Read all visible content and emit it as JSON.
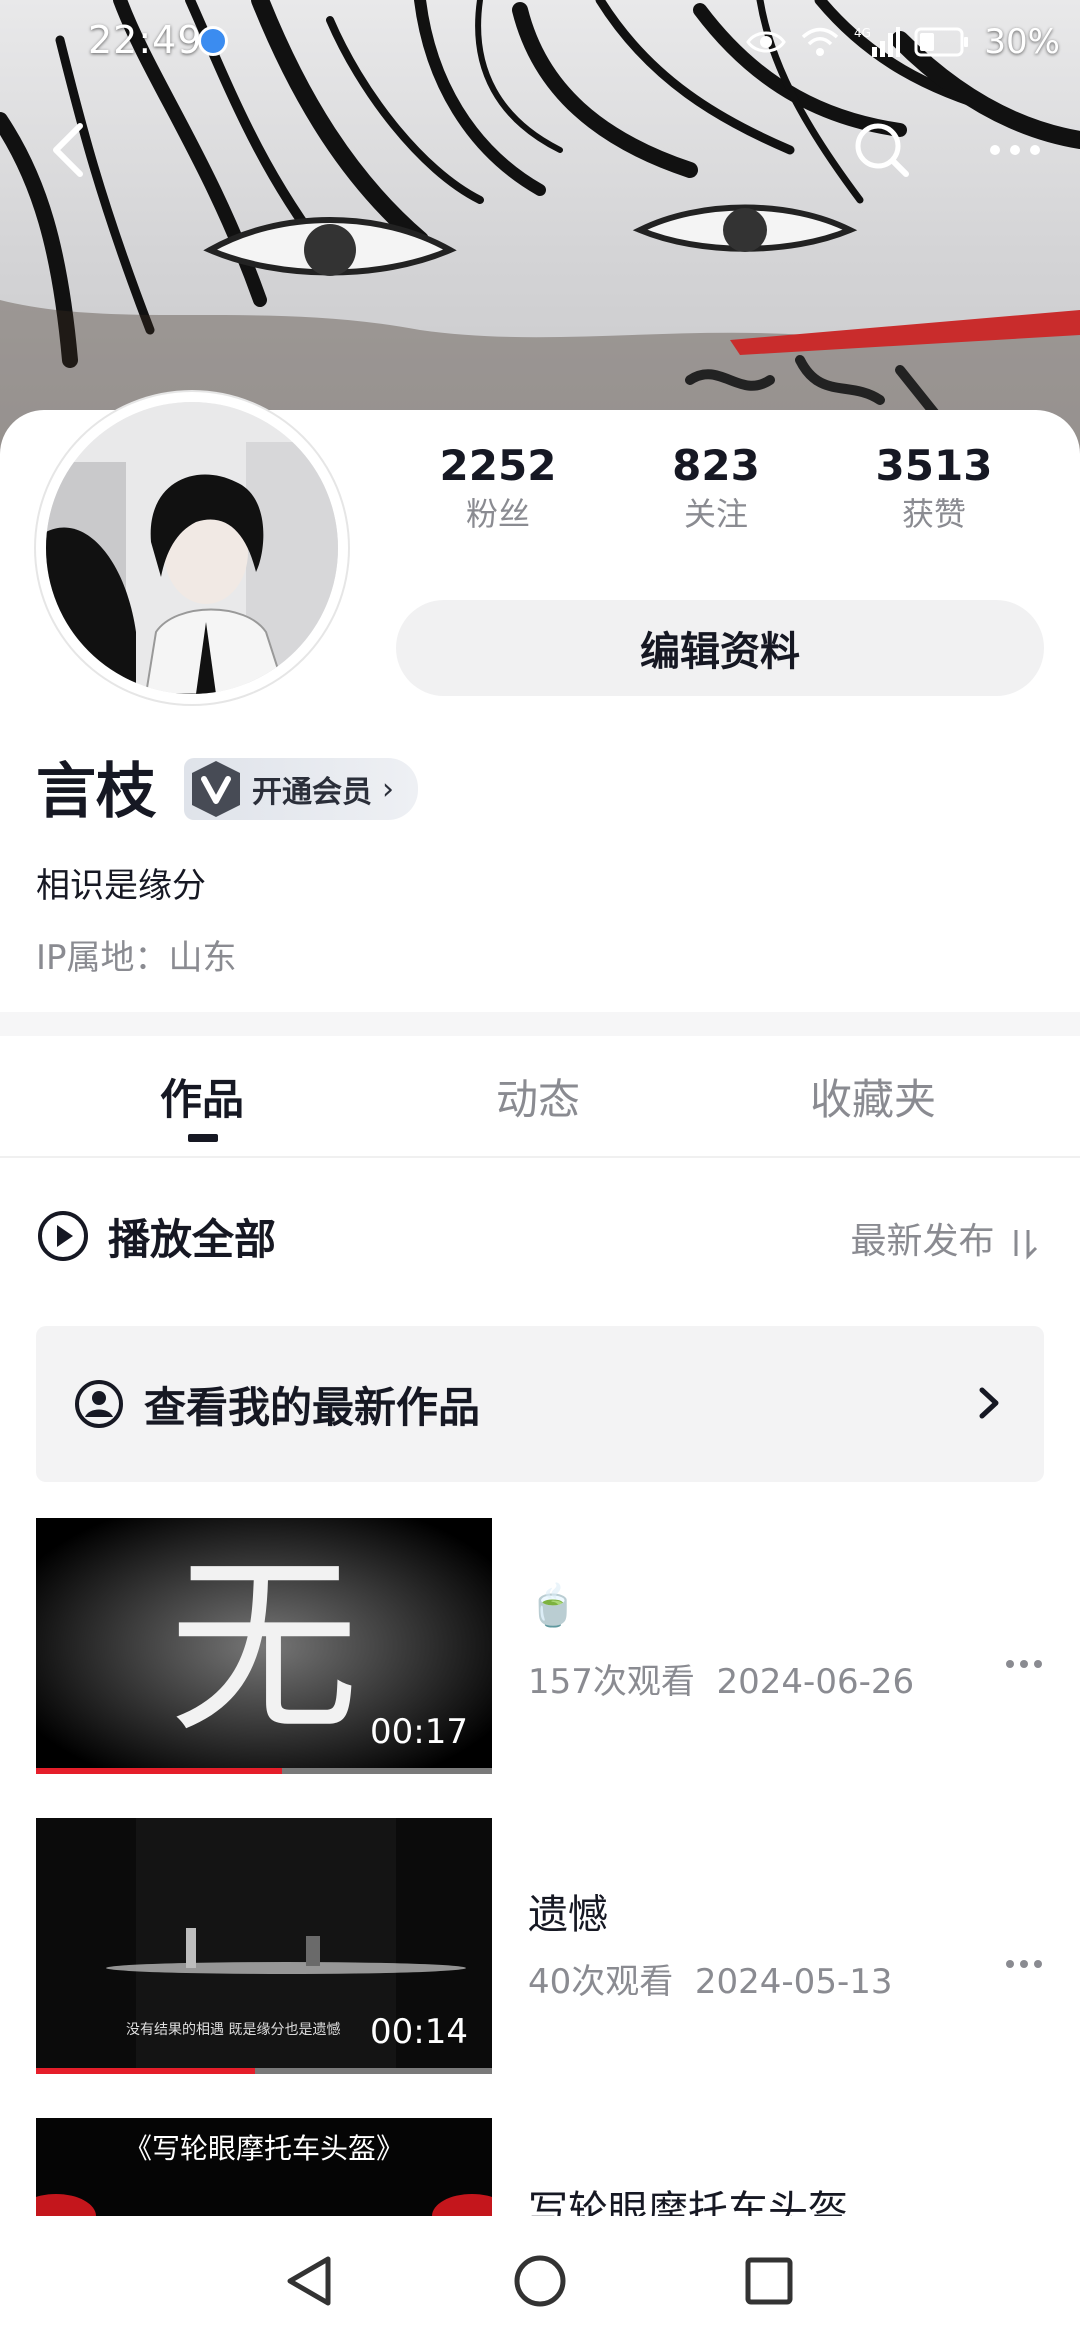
{
  "status_bar": {
    "time": "22:49",
    "network": "4G",
    "battery": "30%",
    "icons": [
      "app-notification-icon",
      "eye-icon",
      "wifi-icon",
      "signal-icon",
      "battery-icon"
    ]
  },
  "header": {
    "icons": [
      "back-icon",
      "search-icon",
      "more-icon"
    ]
  },
  "profile": {
    "stats": [
      {
        "value": "2252",
        "label": "粉丝"
      },
      {
        "value": "823",
        "label": "关注"
      },
      {
        "value": "3513",
        "label": "获赞"
      }
    ],
    "edit_button": "编辑资料",
    "name": "言枝",
    "vip_label": "开通会员",
    "bio": "相识是缘分",
    "ip": "IP属地：山东"
  },
  "tabs": [
    {
      "label": "作品",
      "active": true
    },
    {
      "label": "动态",
      "active": false
    },
    {
      "label": "收藏夹",
      "active": false
    }
  ],
  "play_all": {
    "label": "播放全部",
    "sort": "最新发布"
  },
  "latest_banner": {
    "label": "查看我的最新作品"
  },
  "videos": [
    {
      "title": "🍵",
      "views": "157次观看",
      "date": "2024-06-26",
      "duration": "00:17",
      "progress": 0.54,
      "thumb_text": "无"
    },
    {
      "title": "遗憾",
      "views": "40次观看",
      "date": "2024-05-13",
      "duration": "00:14",
      "progress": 0.48,
      "thumb_caption": "没有结果的相遇 既是缘分也是遗憾"
    },
    {
      "title": "写轮眼摩托车头盔",
      "thumb_caption": "《写轮眼摩托车头盔》"
    }
  ],
  "colors": {
    "accent_red": "#e51e2a",
    "text_primary": "#161823",
    "text_secondary": "#8a8b91"
  }
}
